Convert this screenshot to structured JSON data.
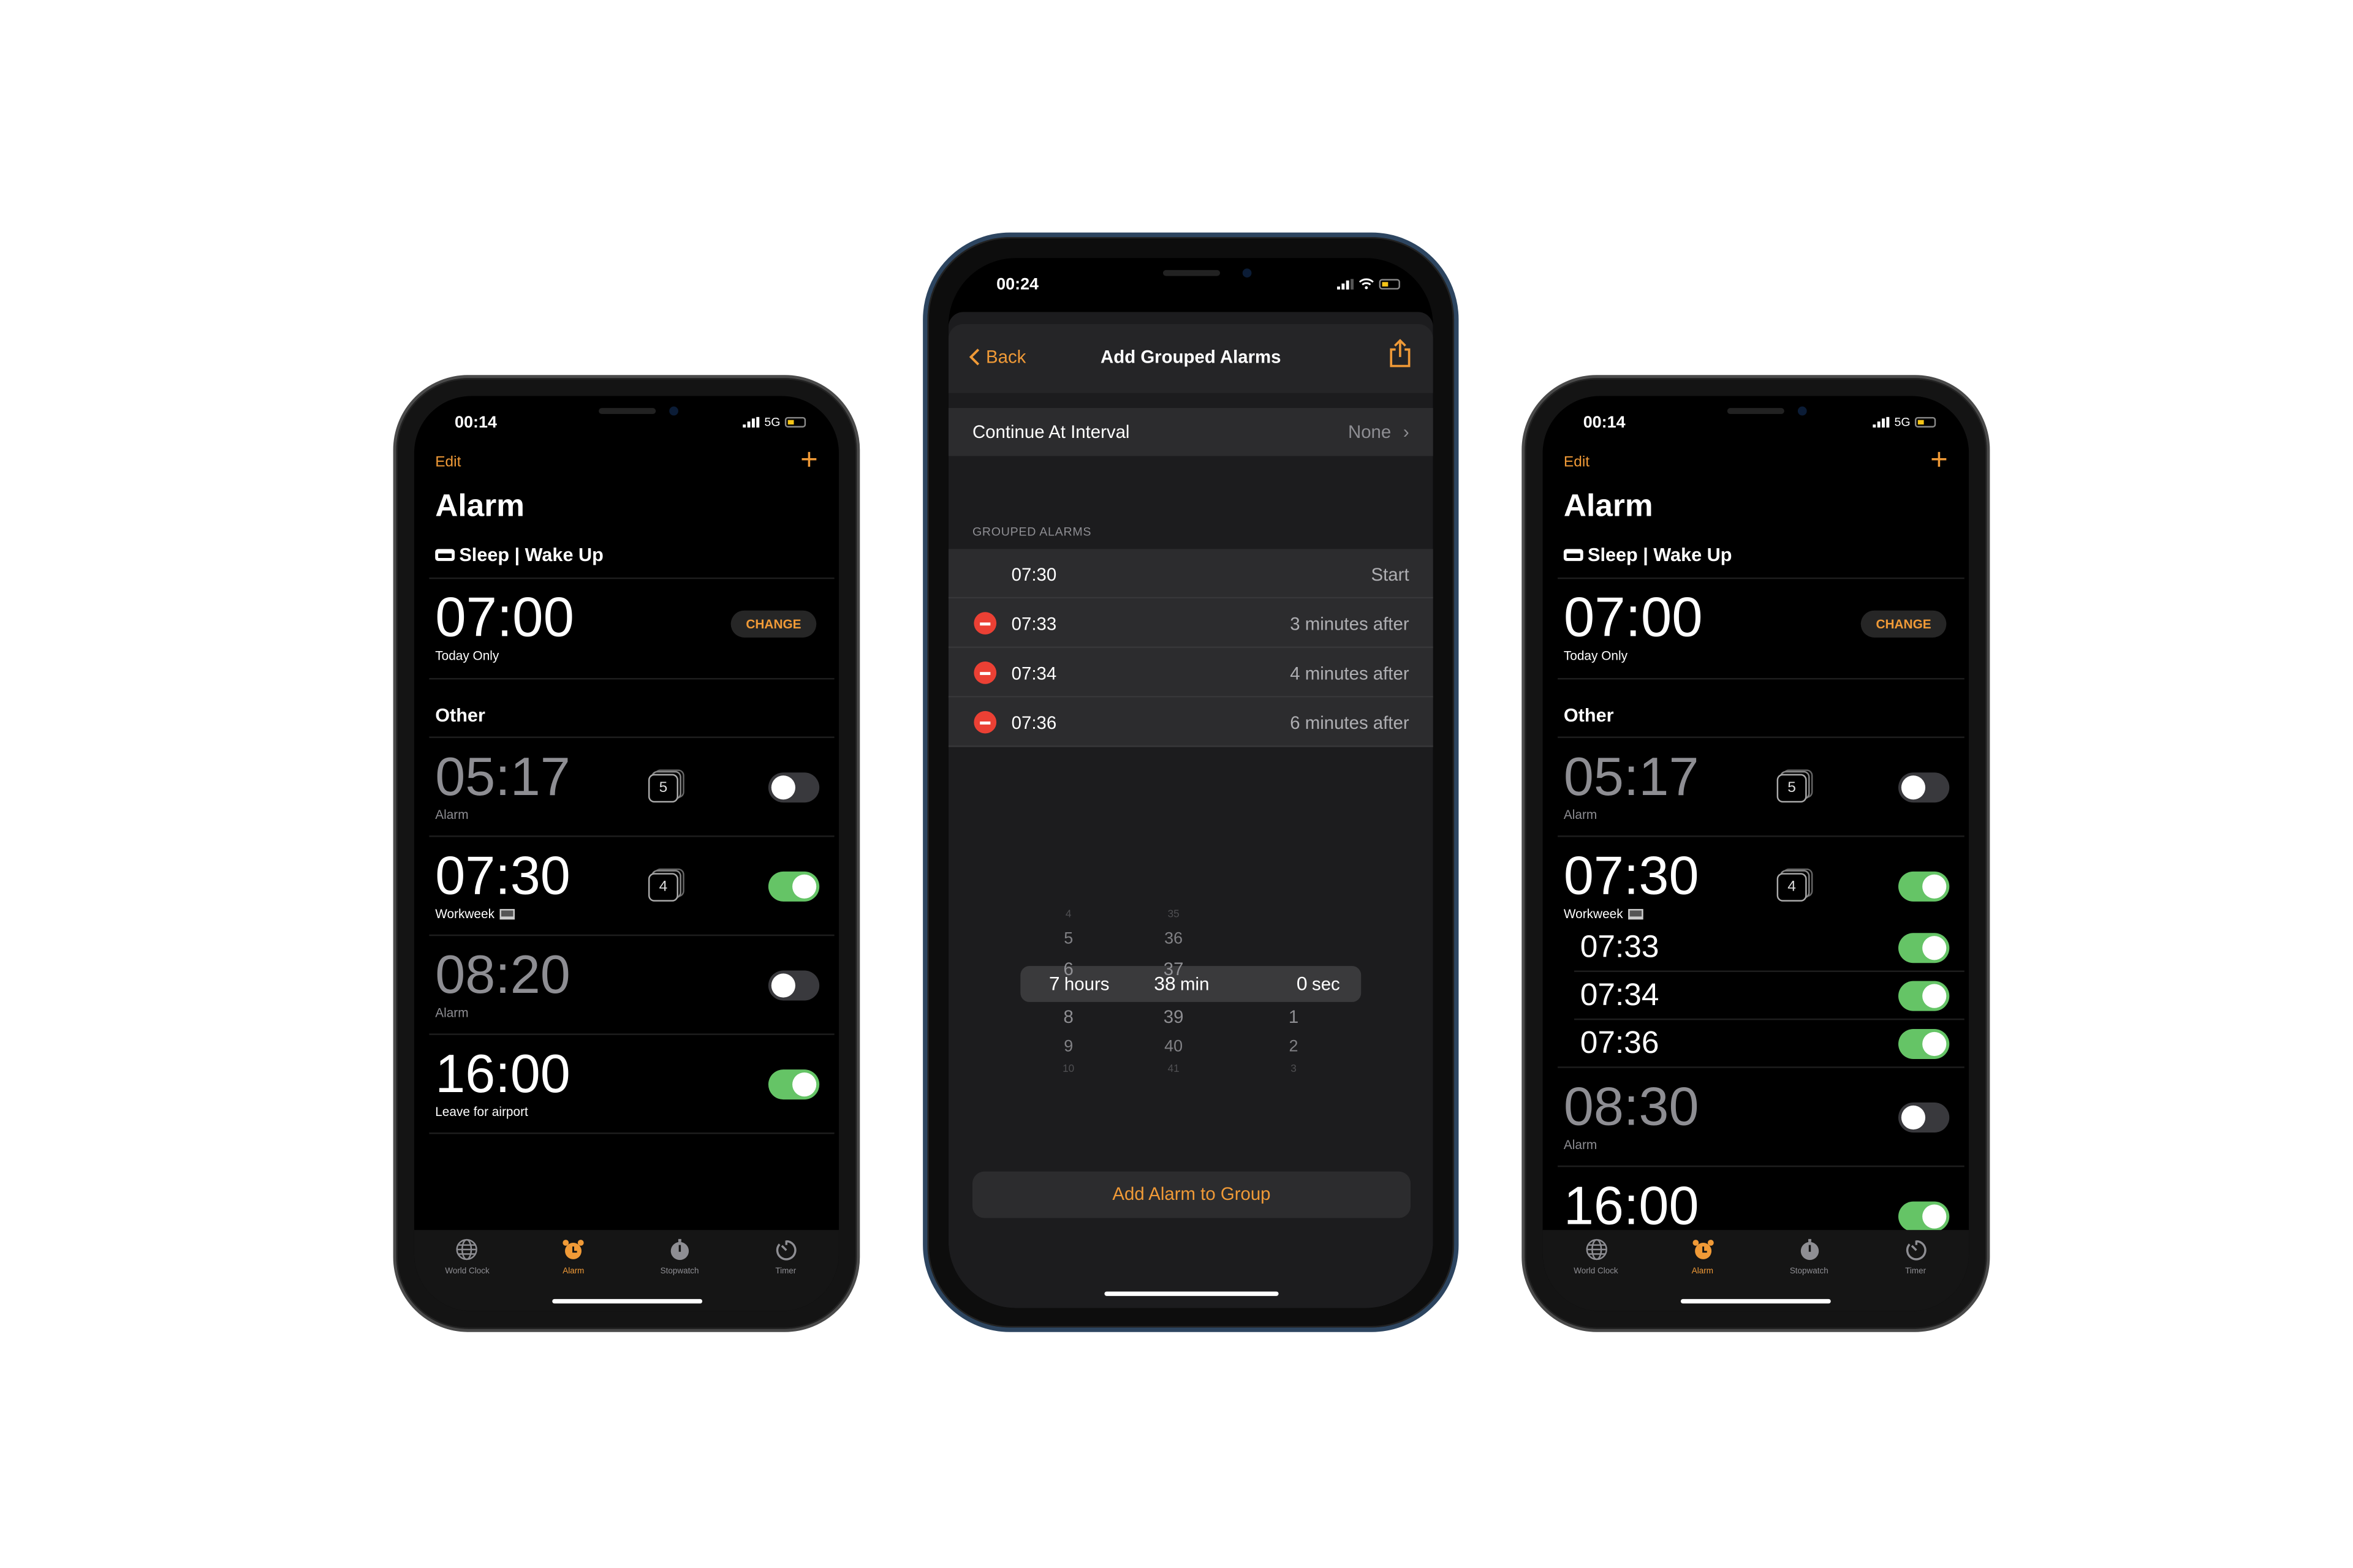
{
  "colors": {
    "accent": "#f09a37",
    "toggle_on": "#65c466",
    "toggle_off": "#39393d",
    "delete": "#eb4034"
  },
  "left_phone": {
    "status": {
      "time": "00:14",
      "network": "5G"
    },
    "nav": {
      "edit": "Edit",
      "add_icon": "plus-icon"
    },
    "title": "Alarm",
    "sleep": {
      "label": "Sleep | Wake Up",
      "time": "07:00",
      "sub": "Today Only",
      "button": "CHANGE"
    },
    "other_heading": "Other",
    "alarms": [
      {
        "time": "05:17",
        "label": "Alarm",
        "enabled": false,
        "badge": "5"
      },
      {
        "time": "07:30",
        "label": "Workweek",
        "enabled": true,
        "badge": "4",
        "laptop": true
      },
      {
        "time": "08:20",
        "label": "Alarm",
        "enabled": false
      },
      {
        "time": "16:00",
        "label": "Leave for airport",
        "enabled": true
      }
    ],
    "tabs": [
      {
        "label": "World Clock",
        "icon": "globe-icon"
      },
      {
        "label": "Alarm",
        "icon": "alarm-clock-icon",
        "active": true
      },
      {
        "label": "Stopwatch",
        "icon": "stopwatch-icon"
      },
      {
        "label": "Timer",
        "icon": "timer-icon"
      }
    ]
  },
  "center_phone": {
    "status": {
      "time": "00:24"
    },
    "header": {
      "back": "Back",
      "title": "Add Grouped Alarms",
      "share_icon": "share-icon"
    },
    "interval": {
      "label": "Continue At Interval",
      "value": "None"
    },
    "group_heading": "GROUPED ALARMS",
    "grouped": [
      {
        "time": "07:30",
        "detail": "Start",
        "deletable": false
      },
      {
        "time": "07:33",
        "detail": "3 minutes after",
        "deletable": true
      },
      {
        "time": "07:34",
        "detail": "4 minutes after",
        "deletable": true
      },
      {
        "time": "07:36",
        "detail": "6 minutes after",
        "deletable": true
      }
    ],
    "picker": {
      "hours": {
        "values": [
          "4",
          "5",
          "6",
          "7",
          "8",
          "9",
          "10"
        ],
        "selected": "7",
        "unit": "hours"
      },
      "minutes": {
        "values": [
          "35",
          "36",
          "37",
          "38",
          "39",
          "40",
          "41"
        ],
        "selected": "38",
        "unit": "min"
      },
      "seconds": {
        "values": [
          "",
          "",
          "",
          "0",
          "1",
          "2",
          "3"
        ],
        "selected": "0",
        "unit": "sec"
      }
    },
    "add_button": "Add Alarm to Group"
  },
  "right_phone": {
    "status": {
      "time": "00:14",
      "network": "5G"
    },
    "nav": {
      "edit": "Edit",
      "add_icon": "plus-icon"
    },
    "title": "Alarm",
    "sleep": {
      "label": "Sleep | Wake Up",
      "time": "07:00",
      "sub": "Today Only",
      "button": "CHANGE"
    },
    "other_heading": "Other",
    "alarms": [
      {
        "time": "05:17",
        "label": "Alarm",
        "enabled": false,
        "badge": "5"
      },
      {
        "time": "07:30",
        "label": "Workweek",
        "enabled": true,
        "badge": "4",
        "laptop": true,
        "subalarms": [
          {
            "time": "07:33",
            "enabled": true
          },
          {
            "time": "07:34",
            "enabled": true
          },
          {
            "time": "07:36",
            "enabled": true
          }
        ]
      },
      {
        "time": "08:30",
        "label": "Alarm",
        "enabled": false
      },
      {
        "time": "16:00",
        "label": "",
        "enabled": true
      }
    ],
    "tabs": [
      {
        "label": "World Clock",
        "icon": "globe-icon"
      },
      {
        "label": "Alarm",
        "icon": "alarm-clock-icon",
        "active": true
      },
      {
        "label": "Stopwatch",
        "icon": "stopwatch-icon"
      },
      {
        "label": "Timer",
        "icon": "timer-icon"
      }
    ]
  }
}
